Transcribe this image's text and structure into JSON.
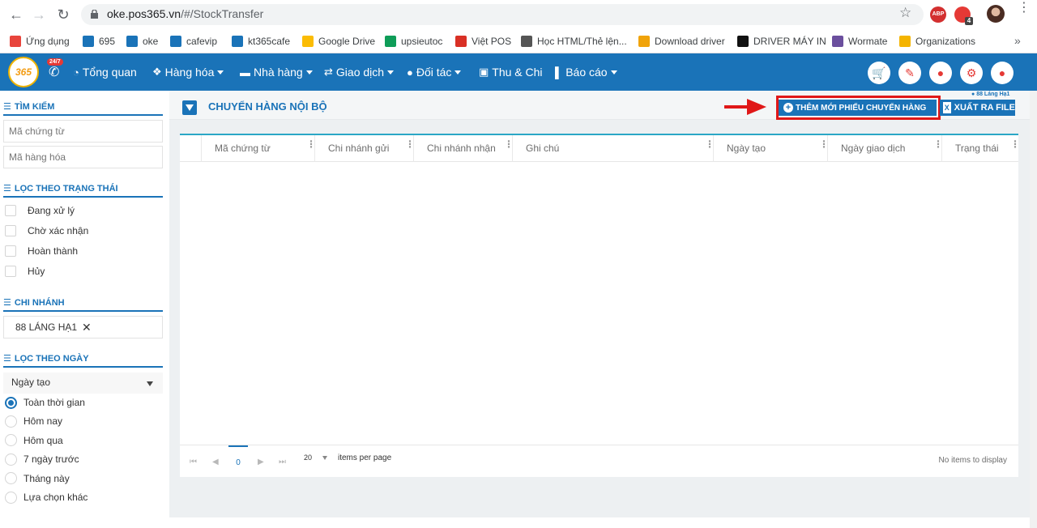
{
  "browser": {
    "url_host": "oke.pos365.vn",
    "url_path": "/#/StockTransfer",
    "ext_abp": "ABP",
    "ext_badge": "4",
    "bookmarks": [
      {
        "label": "Ứng dụng",
        "color": "#e8453c"
      },
      {
        "label": "695",
        "color": "#1a73b8"
      },
      {
        "label": "oke",
        "color": "#1a73b8"
      },
      {
        "label": "cafevip",
        "color": "#1a73b8"
      },
      {
        "label": "kt365cafe",
        "color": "#1a73b8"
      },
      {
        "label": "Google Drive",
        "color": "#fbbc04"
      },
      {
        "label": "upsieutoc",
        "color": "#0f9d58"
      },
      {
        "label": "Việt POS",
        "color": "#d93025"
      },
      {
        "label": "Học HTML/Thẻ lện...",
        "color": "#555555"
      },
      {
        "label": "Download driver",
        "color": "#f0a30a"
      },
      {
        "label": "DRIVER MÁY IN",
        "color": "#111111"
      },
      {
        "label": "Wormate",
        "color": "#6b4f9e"
      },
      {
        "label": "Organizations",
        "color": "#f4b400"
      }
    ],
    "more": "»"
  },
  "appnav": {
    "logo": "365",
    "badge": "24/7",
    "menus": [
      {
        "label": "Tổng quan",
        "icon": "dashboard-icon",
        "caret": false
      },
      {
        "label": "Hàng hóa",
        "icon": "cubes-icon",
        "caret": true
      },
      {
        "label": "Nhà hàng",
        "icon": "restaurant-icon",
        "caret": true
      },
      {
        "label": "Giao dịch",
        "icon": "exchange-icon",
        "caret": true
      },
      {
        "label": "Đối tác",
        "icon": "users-icon",
        "caret": true
      },
      {
        "label": "Thu & Chi",
        "icon": "money-icon",
        "caret": false
      },
      {
        "label": "Báo cáo",
        "icon": "chart-icon",
        "caret": true
      }
    ]
  },
  "sidebar": {
    "search_title": "TÌM KIẾM",
    "search_voucher_placeholder": "Mã chứng từ",
    "search_product_placeholder": "Mã hàng hóa",
    "status_title": "LỌC THEO TRẠNG THÁI",
    "statuses": [
      "Đang xử lý",
      "Chờ xác nhận",
      "Hoàn thành",
      "Hủy"
    ],
    "branch_title": "CHI NHÁNH",
    "branch_selected": "88 LÁNG HẠ1",
    "date_title": "LỌC THEO NGÀY",
    "date_field": "Ngày tạo",
    "date_options": [
      "Toàn thời gian",
      "Hôm nay",
      "Hôm qua",
      "7 ngày trước",
      "Tháng này",
      "Lựa chọn khác"
    ],
    "date_selected_index": 0
  },
  "main": {
    "title": "CHUYỂN HÀNG NỘI BỘ",
    "branch_tag": "88 Láng Hạ1",
    "add_button": "THÊM MỚI PHIẾU CHUYỂN HÀNG",
    "export_button": "XUẤT RA FILE",
    "columns": [
      "Mã chứng từ",
      "Chi nhánh gửi",
      "Chi nhánh nhận",
      "Ghi chú",
      "Ngày tạo",
      "Ngày giao dịch",
      "Trạng thái"
    ],
    "pager": {
      "current_page": "0",
      "page_size": "20",
      "items_per_page": "items per page",
      "empty_text": "No items to display"
    }
  },
  "colors": {
    "primary": "#1a73b8",
    "highlight": "#e01818"
  }
}
